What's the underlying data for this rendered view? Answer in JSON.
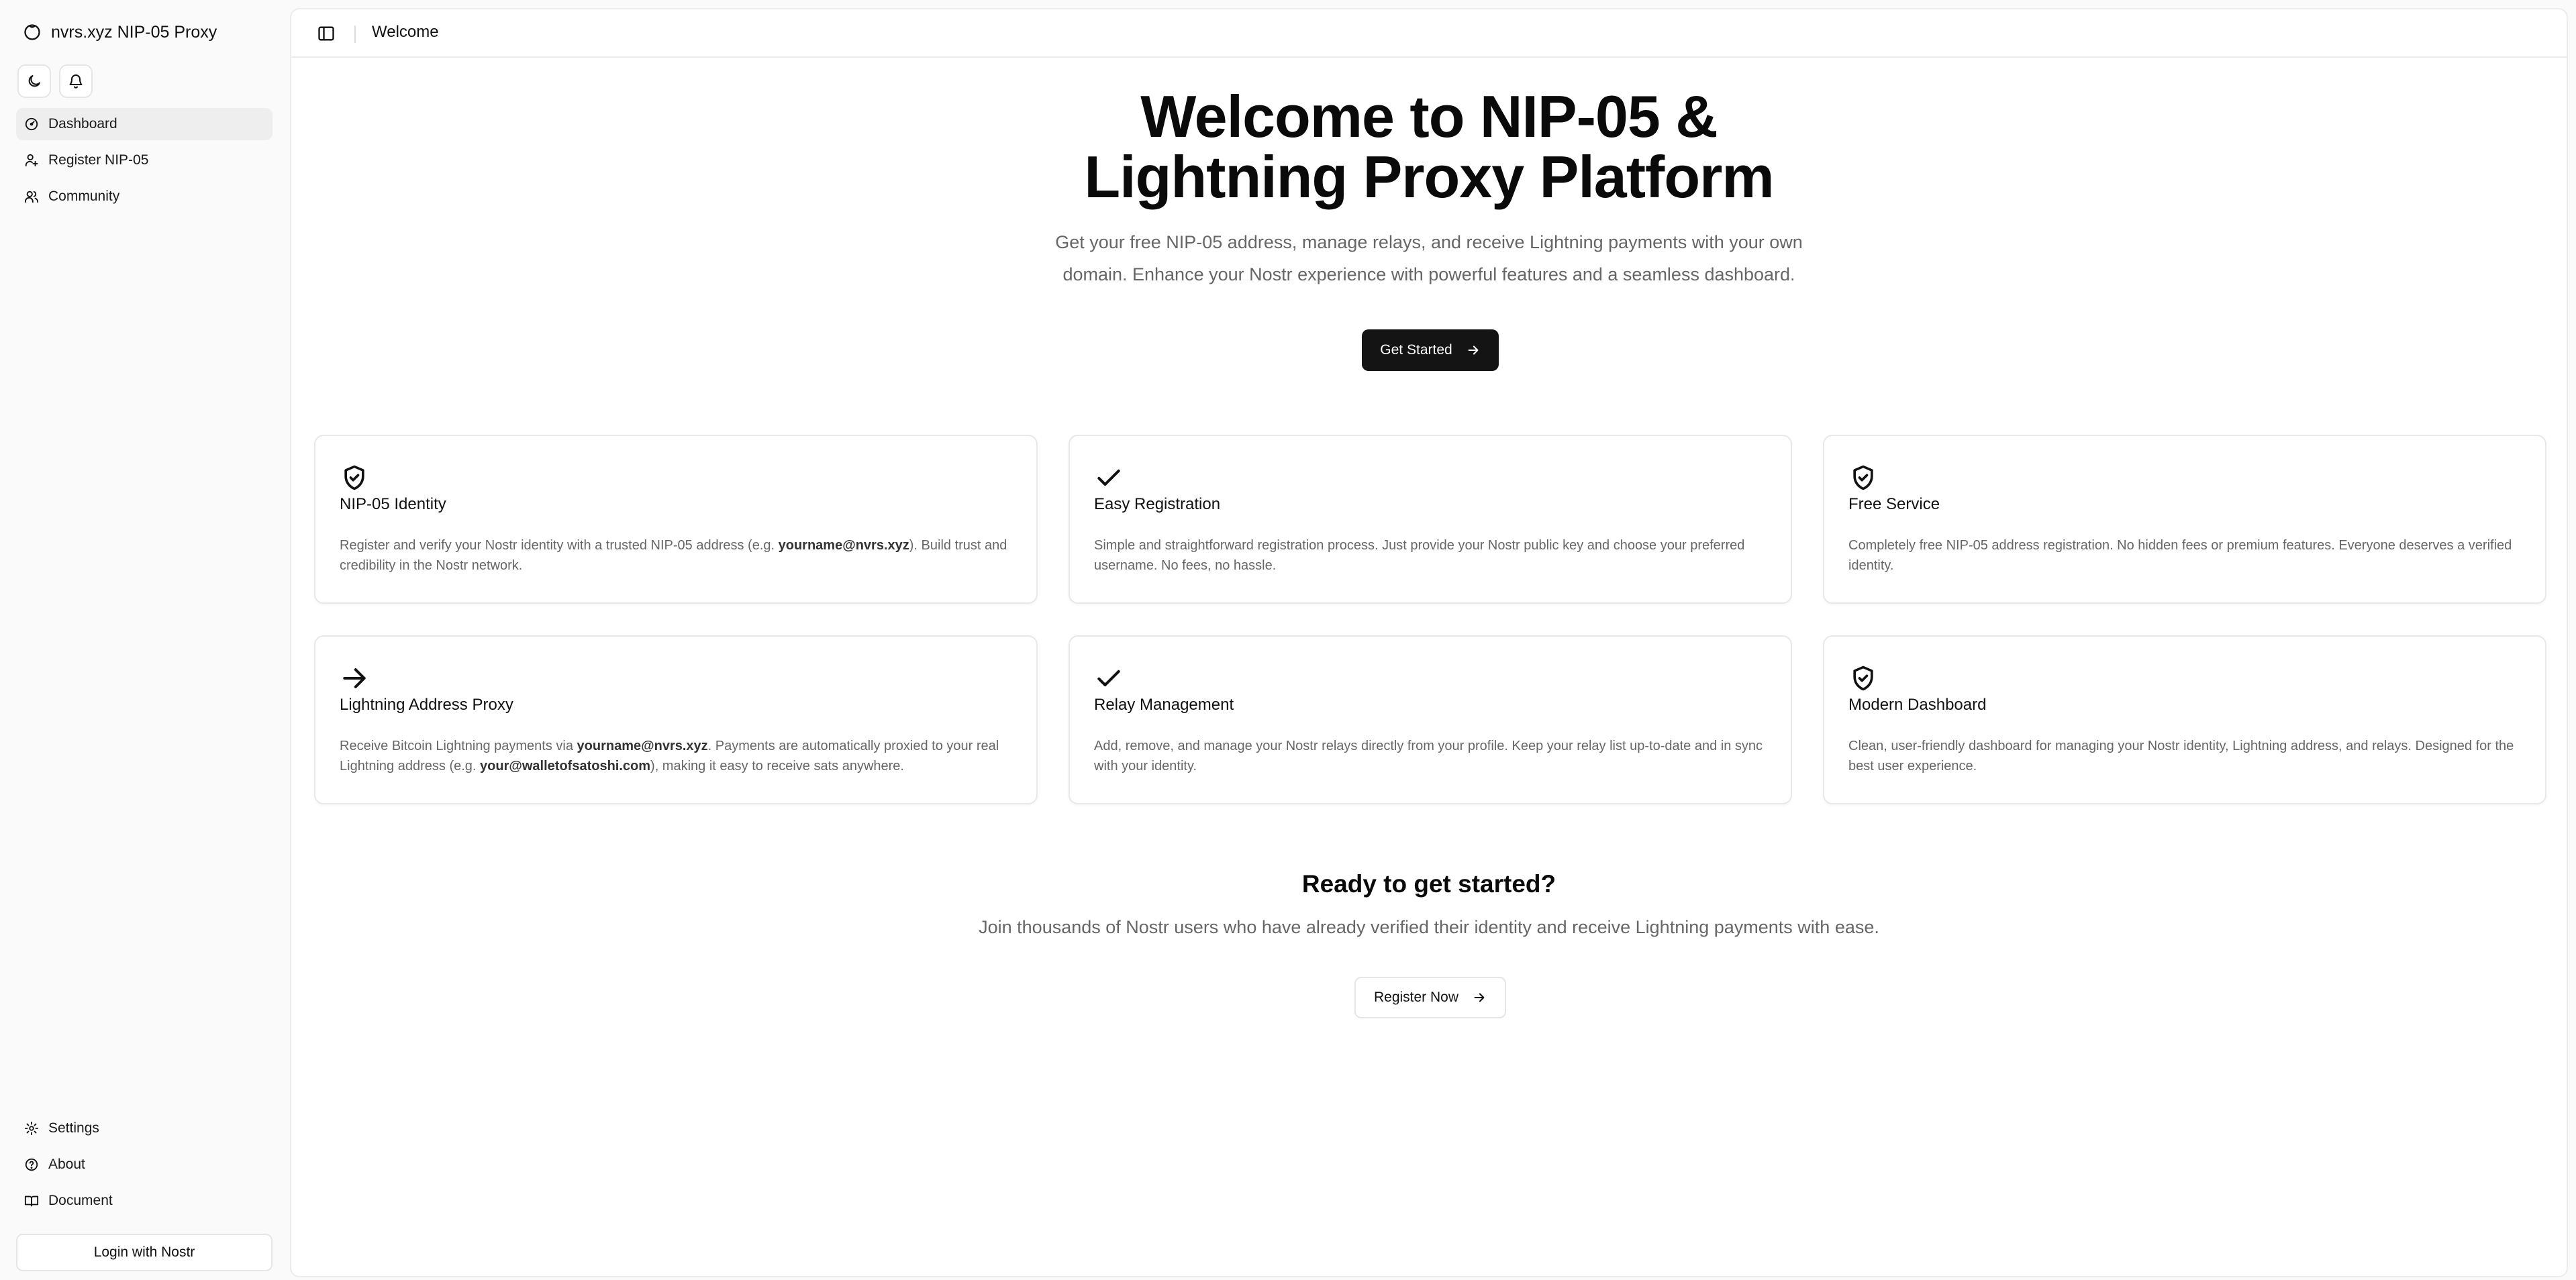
{
  "app": {
    "title": "nvrs.xyz NIP-05 Proxy"
  },
  "sidebar": {
    "top_items": [
      {
        "label": "Dashboard",
        "icon": "dashboard-icon",
        "active": true
      },
      {
        "label": "Register NIP-05",
        "icon": "user-plus-icon",
        "active": false
      },
      {
        "label": "Community",
        "icon": "users-icon",
        "active": false
      }
    ],
    "bottom_items": [
      {
        "label": "Settings",
        "icon": "gear-icon"
      },
      {
        "label": "About",
        "icon": "help-circle-icon"
      },
      {
        "label": "Document",
        "icon": "book-icon"
      }
    ],
    "login_label": "Login with Nostr"
  },
  "topbar": {
    "title": "Welcome"
  },
  "hero": {
    "title": "Welcome to NIP-05 & Lightning Proxy Platform",
    "subtitle": "Get your free NIP-05 address, manage relays, and receive Lightning payments with your own domain. Enhance your Nostr experience with powerful features and a seamless dashboard.",
    "button_label": "Get Started"
  },
  "features": [
    {
      "title": "NIP-05 Identity",
      "icon": "shield-check-icon",
      "desc_parts": [
        {
          "text": "Register and verify your Nostr identity with a trusted NIP-05 address (e.g. ",
          "bold": false
        },
        {
          "text": "yourname@nvrs.xyz",
          "bold": true
        },
        {
          "text": "). Build trust and credibility in the Nostr network.",
          "bold": false
        }
      ]
    },
    {
      "title": "Easy Registration",
      "icon": "check-icon",
      "desc_parts": [
        {
          "text": "Simple and straightforward registration process. Just provide your Nostr public key and choose your preferred username. No fees, no hassle.",
          "bold": false
        }
      ]
    },
    {
      "title": "Free Service",
      "icon": "shield-check-icon",
      "desc_parts": [
        {
          "text": "Completely free NIP-05 address registration. No hidden fees or premium features. Everyone deserves a verified identity.",
          "bold": false
        }
      ]
    },
    {
      "title": "Lightning Address Proxy",
      "icon": "arrow-right-icon",
      "desc_parts": [
        {
          "text": "Receive Bitcoin Lightning payments via ",
          "bold": false
        },
        {
          "text": "yourname@nvrs.xyz",
          "bold": true
        },
        {
          "text": ". Payments are automatically proxied to your real Lightning address (e.g. ",
          "bold": false
        },
        {
          "text": "your@walletofsatoshi.com",
          "bold": true
        },
        {
          "text": "), making it easy to receive sats anywhere.",
          "bold": false
        }
      ]
    },
    {
      "title": "Relay Management",
      "icon": "check-icon",
      "desc_parts": [
        {
          "text": "Add, remove, and manage your Nostr relays directly from your profile. Keep your relay list up-to-date and in sync with your identity.",
          "bold": false
        }
      ]
    },
    {
      "title": "Modern Dashboard",
      "icon": "shield-check-icon",
      "desc_parts": [
        {
          "text": "Clean, user-friendly dashboard for managing your Nostr identity, Lightning address, and relays. Designed for the best user experience.",
          "bold": false
        }
      ]
    }
  ],
  "cta": {
    "title": "Ready to get started?",
    "subtitle": "Join thousands of Nostr users who have already verified their identity and receive Lightning payments with ease.",
    "button_label": "Register Now"
  }
}
